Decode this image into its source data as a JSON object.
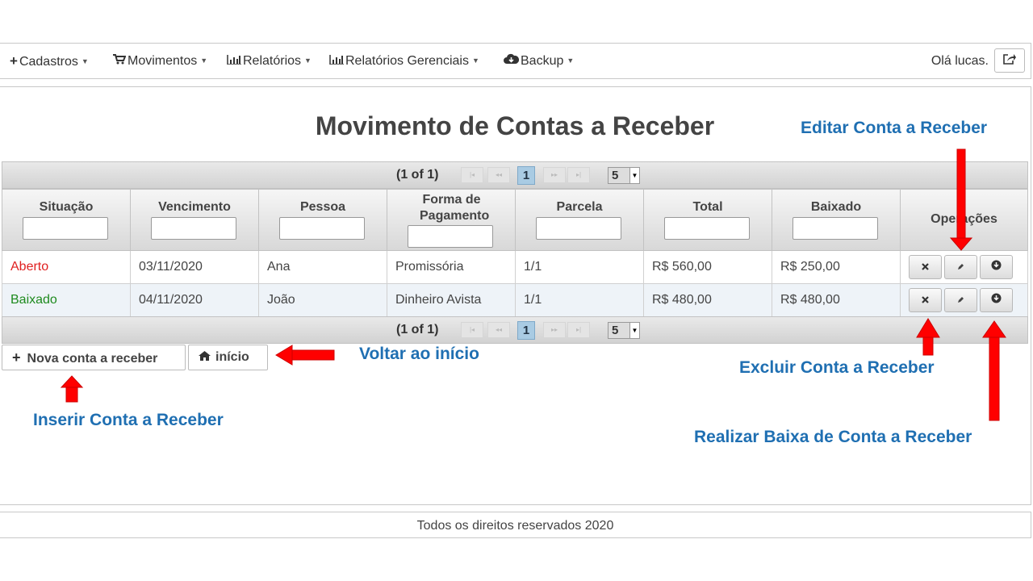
{
  "nav": {
    "menus": [
      {
        "label": "Cadastros",
        "icon": "plus-icon"
      },
      {
        "label": "Movimentos",
        "icon": "cart-icon"
      },
      {
        "label": "Relatórios",
        "icon": "bar-chart-icon"
      },
      {
        "label": "Relatórios Gerenciais",
        "icon": "bar-chart-icon"
      },
      {
        "label": "Backup",
        "icon": "cloud-download-icon"
      }
    ],
    "greeting": "Olá lucas.",
    "logout_icon": "share-icon"
  },
  "page_title": "Movimento de Contas a Receber",
  "paginator": {
    "status": "(1 of 1)",
    "current_page": "1",
    "rows_per_page": "5"
  },
  "table": {
    "columns": [
      "Situação",
      "Vencimento",
      "Pessoa",
      "Forma de Pagamento",
      "Parcela",
      "Total",
      "Baixado",
      "Operações"
    ],
    "rows": [
      {
        "situacao": "Aberto",
        "vencimento": "03/11/2020",
        "pessoa": "Ana",
        "forma": "Promissória",
        "parcela": "1/1",
        "total": "R$ 560,00",
        "baixado": "R$ 250,00"
      },
      {
        "situacao": "Baixado",
        "vencimento": "04/11/2020",
        "pessoa": "João",
        "forma": "Dinheiro Avista",
        "parcela": "1/1",
        "total": "R$ 480,00",
        "baixado": "R$ 480,00"
      }
    ]
  },
  "colors": {
    "aberto": "#e02020",
    "baixado": "#1e8a1e",
    "annotation": "#1f6fb2",
    "arrow": "#ff0000"
  },
  "buttons": {
    "new": "Nova conta a receber",
    "home": "início"
  },
  "annotations": {
    "edit": "Editar Conta a Receber",
    "delete": "Excluir Conta a Receber",
    "settle": "Realizar Baixa de Conta a Receber",
    "back": "Voltar ao início",
    "insert": "Inserir Conta a Receber"
  },
  "footer": "Todos os direitos reservados 2020"
}
